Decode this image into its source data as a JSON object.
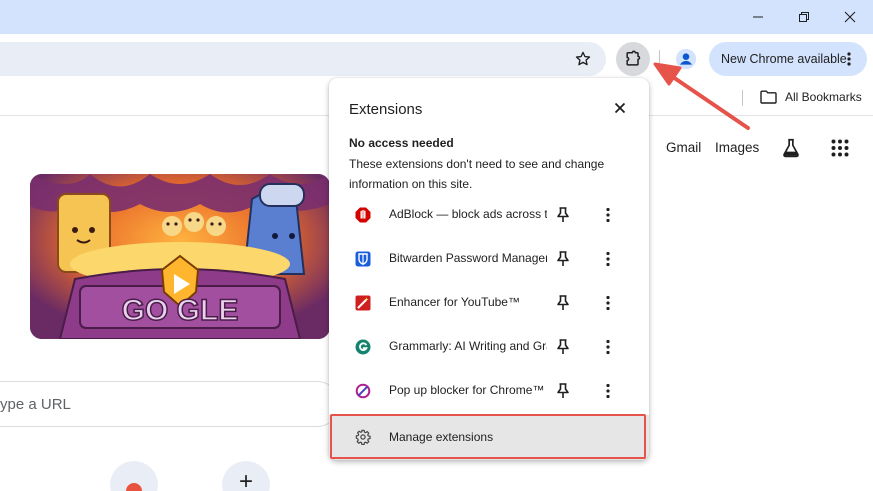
{
  "toolbar": {
    "update_chip_label": "New Chrome available"
  },
  "bookmarks_bar": {
    "all_bookmarks_label": "All Bookmarks"
  },
  "ntp": {
    "gmail_label": "Gmail",
    "images_label": "Images",
    "search_placeholder": "ype a URL",
    "add_shortcut_label": "+"
  },
  "doodle": {
    "logo_letters": "GO  GLE"
  },
  "extensions_panel": {
    "title": "Extensions",
    "section_title": "No access needed",
    "section_description": "These extensions don't need to see and change information on this site.",
    "items": [
      {
        "name": "AdBlock — block ads across the web",
        "icon": "adblock-icon",
        "color": "#d40000"
      },
      {
        "name": "Bitwarden Password Manager",
        "icon": "bitwarden-icon",
        "color": "#175ddc"
      },
      {
        "name": "Enhancer for YouTube™",
        "icon": "enhancer-icon",
        "color": "#d01f1f"
      },
      {
        "name": "Grammarly: AI Writing and Grammar Checker",
        "icon": "grammarly-icon",
        "color": "#15846f"
      },
      {
        "name": "Pop up blocker for Chrome™",
        "icon": "popup-blocker-icon",
        "color": "#b0208f"
      }
    ],
    "manage_label": "Manage extensions"
  },
  "colors": {
    "title_bar": "#d3e3fd",
    "omnibox": "#e9eef6",
    "annotation_red": "#e5534b"
  }
}
